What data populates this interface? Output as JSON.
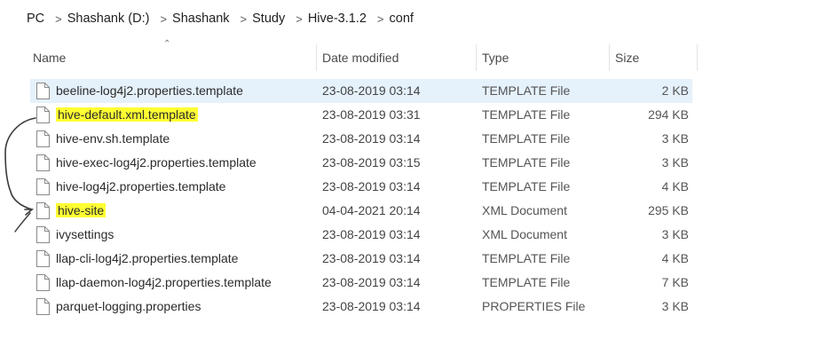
{
  "breadcrumb": [
    "PC",
    "Shashank (D:)",
    "Shashank",
    "Study",
    "Hive-3.1.2",
    "conf"
  ],
  "columns": {
    "name": "Name",
    "date": "Date modified",
    "type": "Type",
    "size": "Size"
  },
  "files": [
    {
      "name": "beeline-log4j2.properties.template",
      "date": "23-08-2019 03:14",
      "type": "TEMPLATE File",
      "size": "2 KB",
      "selected": true,
      "highlight": false
    },
    {
      "name": "hive-default.xml.template",
      "date": "23-08-2019 03:31",
      "type": "TEMPLATE File",
      "size": "294 KB",
      "selected": false,
      "highlight": true
    },
    {
      "name": "hive-env.sh.template",
      "date": "23-08-2019 03:14",
      "type": "TEMPLATE File",
      "size": "3 KB",
      "selected": false,
      "highlight": false
    },
    {
      "name": "hive-exec-log4j2.properties.template",
      "date": "23-08-2019 03:15",
      "type": "TEMPLATE File",
      "size": "3 KB",
      "selected": false,
      "highlight": false
    },
    {
      "name": "hive-log4j2.properties.template",
      "date": "23-08-2019 03:14",
      "type": "TEMPLATE File",
      "size": "4 KB",
      "selected": false,
      "highlight": false
    },
    {
      "name": "hive-site",
      "date": "04-04-2021 20:14",
      "type": "XML Document",
      "size": "295 KB",
      "selected": false,
      "highlight": true
    },
    {
      "name": "ivysettings",
      "date": "23-08-2019 03:14",
      "type": "XML Document",
      "size": "3 KB",
      "selected": false,
      "highlight": false
    },
    {
      "name": "llap-cli-log4j2.properties.template",
      "date": "23-08-2019 03:14",
      "type": "TEMPLATE File",
      "size": "4 KB",
      "selected": false,
      "highlight": false
    },
    {
      "name": "llap-daemon-log4j2.properties.template",
      "date": "23-08-2019 03:14",
      "type": "TEMPLATE File",
      "size": "7 KB",
      "selected": false,
      "highlight": false
    },
    {
      "name": "parquet-logging.properties",
      "date": "23-08-2019 03:14",
      "type": "PROPERTIES File",
      "size": "3 KB",
      "selected": false,
      "highlight": false
    }
  ],
  "colors": {
    "highlight": "#ffff33",
    "selected": "#e5f1fb",
    "annotation": "#3a3a3a"
  }
}
